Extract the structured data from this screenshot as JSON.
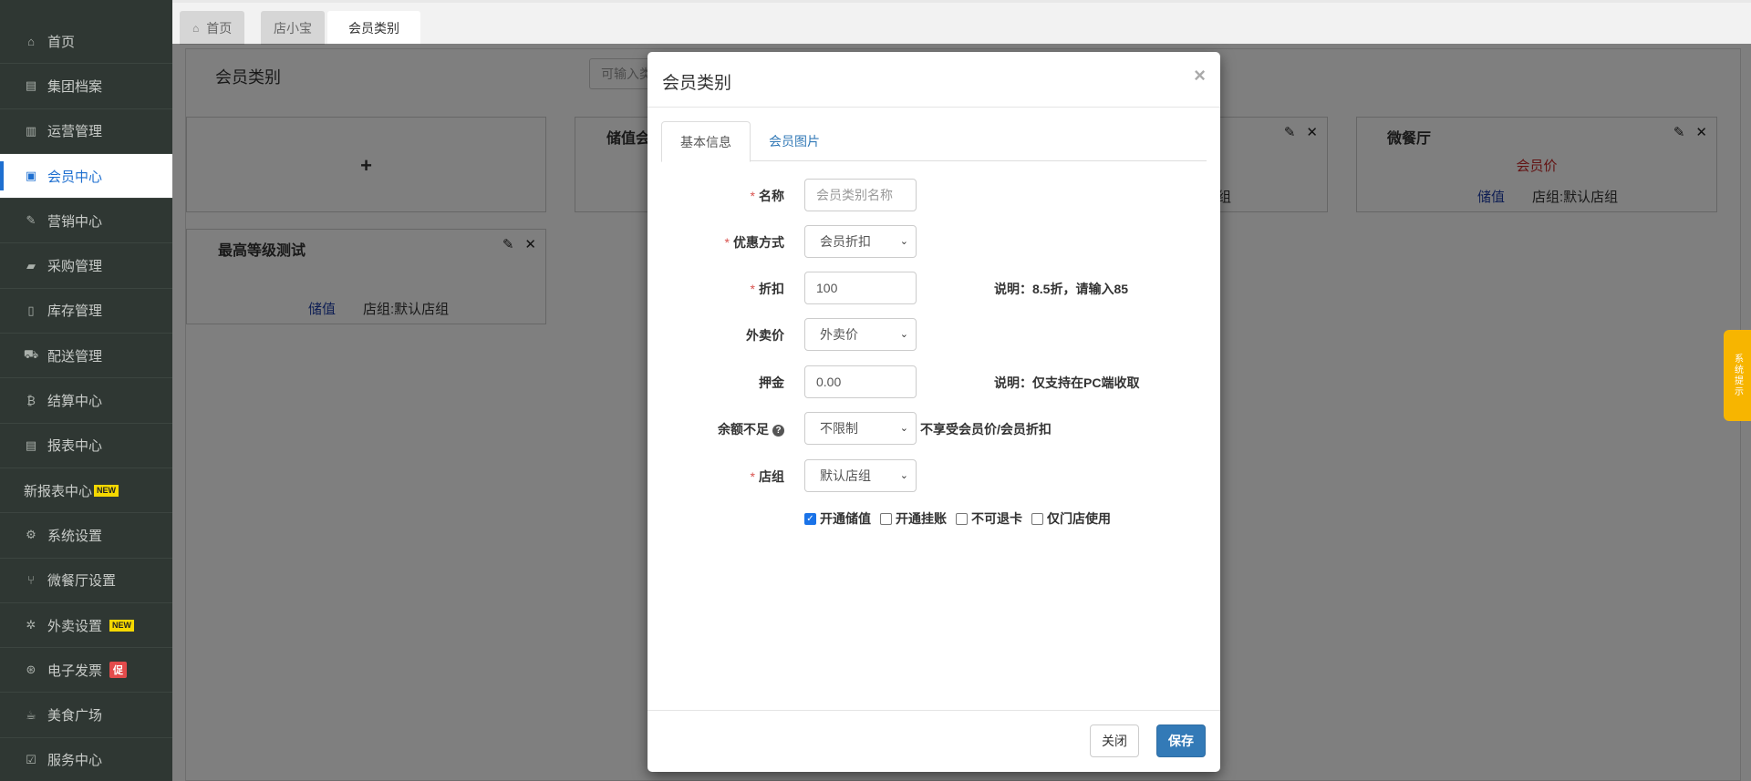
{
  "sidebar": {
    "items": [
      {
        "label": "首页",
        "icon": "home-icon",
        "glyph": "⌂"
      },
      {
        "label": "集团档案",
        "icon": "file-icon",
        "glyph": "▤"
      },
      {
        "label": "运营管理",
        "icon": "bar-chart-icon",
        "glyph": "▥"
      },
      {
        "label": "会员中心",
        "icon": "id-card-icon",
        "glyph": "▣"
      },
      {
        "label": "营销中心",
        "icon": "edit-icon",
        "glyph": "✎"
      },
      {
        "label": "采购管理",
        "icon": "book-icon",
        "glyph": "▰"
      },
      {
        "label": "库存管理",
        "icon": "building-icon",
        "glyph": "▯"
      },
      {
        "label": "配送管理",
        "icon": "truck-icon",
        "glyph": "⛟"
      },
      {
        "label": "结算中心",
        "icon": "bitcoin-icon",
        "glyph": "₿"
      },
      {
        "label": "报表中心",
        "icon": "report-icon",
        "glyph": "▤"
      },
      {
        "label": "新报表中心",
        "badge": "NEW"
      },
      {
        "label": "系统设置",
        "icon": "cogs-icon",
        "glyph": "⚙"
      },
      {
        "label": "微餐厅设置",
        "icon": "cutlery-icon",
        "glyph": "⑂"
      },
      {
        "label": "外卖设置",
        "icon": "gear-icon",
        "glyph": "✲",
        "badge": "NEW"
      },
      {
        "label": "电子发票",
        "icon": "ticket-icon",
        "glyph": "⊛",
        "promo": "促"
      },
      {
        "label": "美食广场",
        "icon": "coffee-icon",
        "glyph": "☕"
      },
      {
        "label": "服务中心",
        "icon": "check-square-icon",
        "glyph": "☑"
      }
    ]
  },
  "tabs": [
    {
      "label": "首页",
      "glyph": "⌂"
    },
    {
      "label": "店小宝"
    },
    {
      "label": "会员类别"
    }
  ],
  "main": {
    "title": "会员类别",
    "search_placeholder": "可输入类",
    "cards": [
      {
        "plus": "+"
      },
      {
        "title": "储值会"
      },
      {
        "bottom_right": "组"
      },
      {
        "title": "微餐厅",
        "red": "会员价",
        "blue": "储值",
        "group": "店组:默认店组"
      },
      {
        "title": "最高等级测试",
        "blue": "储值",
        "group": "店组:默认店组"
      }
    ]
  },
  "system_tip": "系统提示",
  "modal": {
    "title": "会员类别",
    "close": "×",
    "tabs": [
      "基本信息",
      "会员图片"
    ],
    "fields": {
      "name": {
        "label": "名称",
        "placeholder": "会员类别名称"
      },
      "discount_mode": {
        "label": "优惠方式",
        "value": "会员折扣"
      },
      "discount": {
        "label": "折扣",
        "value": "100",
        "hint": "说明：8.5折，请输入85"
      },
      "takeout_price": {
        "label": "外卖价",
        "value": "外卖价"
      },
      "deposit": {
        "label": "押金",
        "value": "0.00",
        "hint": "说明：仅支持在PC端收取"
      },
      "insufficient": {
        "label": "余额不足",
        "value": "不限制",
        "hint": "不享受会员价/会员折扣"
      },
      "store_group": {
        "label": "店组",
        "value": "默认店组"
      }
    },
    "checks": [
      {
        "label": "开通储值",
        "checked": true
      },
      {
        "label": "开通挂账",
        "checked": false
      },
      {
        "label": "不可退卡",
        "checked": false
      },
      {
        "label": "仅门店使用",
        "checked": false
      }
    ],
    "buttons": {
      "close": "关闭",
      "save": "保存"
    }
  },
  "colors": {
    "accent": "#337ab7",
    "sidebar_bg": "#2f3733",
    "required": "#d9534f",
    "tip": "#f7b500"
  }
}
